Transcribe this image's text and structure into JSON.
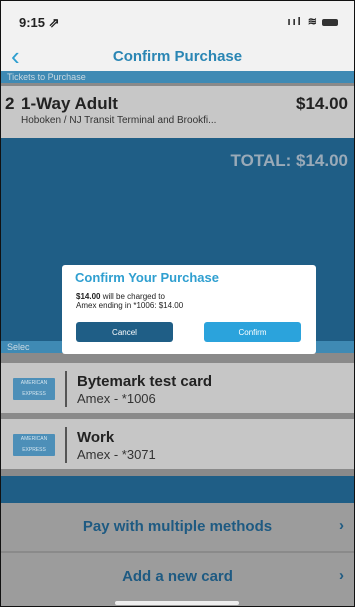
{
  "status_bar": {
    "time": "9:15 ⇗",
    "icons": "ııl ≋"
  },
  "nav": {
    "back_glyph": "‹",
    "title": "Confirm Purchase"
  },
  "tickets_section": {
    "header": "Tickets to Purchase"
  },
  "ticket": {
    "quantity": "2",
    "name": "1-Way Adult",
    "price": "$14.00",
    "route": "Hoboken / NJ Transit Terminal and Brookfi..."
  },
  "total": {
    "label": "TOTAL: $14.00"
  },
  "payment_section": {
    "header": "Selec"
  },
  "cards": [
    {
      "brand_logo": "AMERICAN EXPRESS",
      "name": "Bytemark test card",
      "number": "Amex - *1006"
    },
    {
      "brand_logo": "AMERICAN EXPRESS",
      "name": "Work",
      "number": "Amex - *3071"
    }
  ],
  "actions": {
    "pay_multiple": "Pay with multiple methods",
    "add_card": "Add a new card",
    "chevron": "›"
  },
  "modal": {
    "title": "Confirm Your Purchase",
    "amount": "$14.00",
    "amount_suffix": " will be charged to",
    "detail": "Amex ending in *1006: $14.00",
    "cancel_label": "Cancel",
    "confirm_label": "Confirm"
  },
  "colors": {
    "accent": "#2f9fd0",
    "panel_blue": "#1f5e86",
    "confirm_button": "#2ba3dc"
  }
}
